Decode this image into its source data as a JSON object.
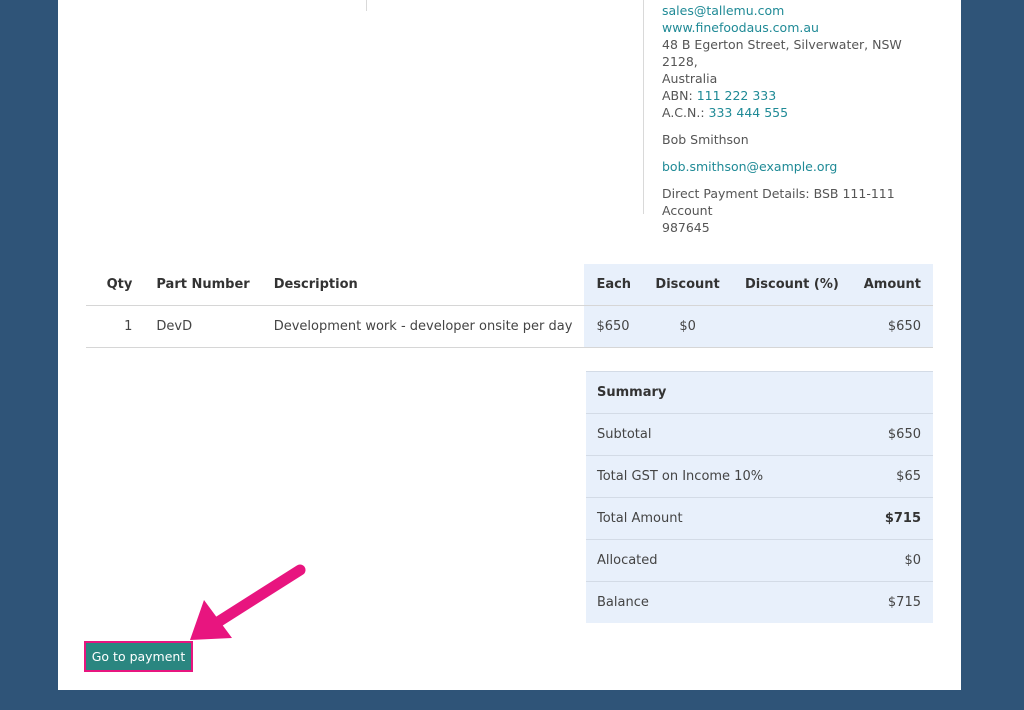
{
  "vendor": {
    "email": "sales@tallemu.com",
    "website": "www.finefoodaus.com.au",
    "address_line1": "48 B Egerton Street, Silverwater, NSW 2128,",
    "address_line2": "Australia",
    "abn_label": "ABN:",
    "abn_value": "111 222 333",
    "acn_label": "A.C.N.:",
    "acn_value": "333 444 555",
    "contact_name": "Bob Smithson",
    "contact_email": "bob.smithson@example.org",
    "payment_details_line1": "Direct Payment Details: BSB 111-111 Account",
    "payment_details_line2": "987645"
  },
  "items": {
    "headers": {
      "qty": "Qty",
      "part_number": "Part Number",
      "description": "Description",
      "each": "Each",
      "discount": "Discount",
      "discount_pct": "Discount (%)",
      "amount": "Amount"
    },
    "rows": [
      {
        "qty": "1",
        "part_number": "DevD",
        "description": "Development work - developer onsite per day",
        "each": "$650",
        "discount": "$0",
        "discount_pct": "",
        "amount": "$650"
      }
    ]
  },
  "summary": {
    "title": "Summary",
    "subtotal_label": "Subtotal",
    "subtotal_value": "$650",
    "gst_label": "Total GST on Income 10%",
    "gst_value": "$65",
    "total_label": "Total Amount",
    "total_value": "$715",
    "allocated_label": "Allocated",
    "allocated_value": "$0",
    "balance_label": "Balance",
    "balance_value": "$715"
  },
  "actions": {
    "go_to_payment": "Go to payment"
  },
  "colors": {
    "background": "#2f5478",
    "link": "#1f8a96",
    "button": "#2a8680",
    "highlight": "#e8157f",
    "table_shade": "#e8f0fb"
  }
}
